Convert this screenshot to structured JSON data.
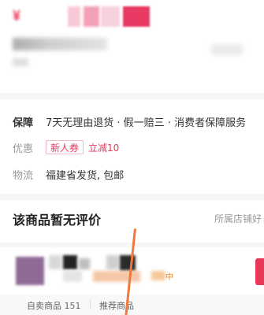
{
  "top": {
    "price_prefix": "¥"
  },
  "info": {
    "guarantee_label": "保障",
    "guarantee_text": "7天无理由退货 · 假一赔三 · 消费者保障服务",
    "promo_label": "优惠",
    "coupon_tag": "新人券",
    "coupon_action": "立减10",
    "shipping_label": "物流",
    "shipping_text": "福建省发货, 包邮"
  },
  "reviews": {
    "title": "该商品暂无评价",
    "store_link": "所属店铺好"
  },
  "store": {
    "badge_text": "中",
    "stat_own_goods": "自卖商品 151",
    "stat_recommended": "推荐商品"
  },
  "colors": {
    "accent": "#e8385a",
    "swipe_line": "#f0783c"
  }
}
